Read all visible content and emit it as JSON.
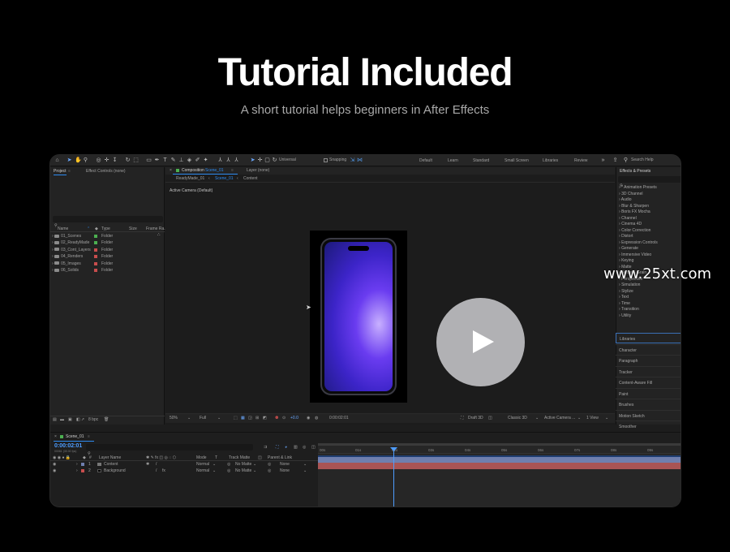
{
  "hero": {
    "title": "Tutorial Included",
    "subtitle": "A short tutorial helps beginners in After Effects"
  },
  "watermark": "www.25xt.com",
  "toolbar": {
    "universal_label": "Universal",
    "snapping_label": "Snapping",
    "workspaces": [
      "Default",
      "Learn",
      "Standard",
      "Small Screen",
      "Libraries",
      "Review"
    ],
    "search_placeholder": "Search Help"
  },
  "project_panel": {
    "tab_project": "Project",
    "tab_effect_controls": "Effect Controls (none)",
    "columns": [
      "Name",
      "Type",
      "Size",
      "Frame Ra..."
    ],
    "items": [
      {
        "name": "01_Scenes",
        "type": "Folder",
        "color": "#4caf50"
      },
      {
        "name": "02_ReadyMade",
        "type": "Folder",
        "color": "#4caf50"
      },
      {
        "name": "03_Cont_Layers",
        "type": "Folder",
        "color": "#c84d4d"
      },
      {
        "name": "04_Renders",
        "type": "Folder",
        "color": "#c84d4d"
      },
      {
        "name": "05_Images",
        "type": "Folder",
        "color": "#c84d4d"
      },
      {
        "name": "06_Solids",
        "type": "Folder",
        "color": "#c84d4d"
      }
    ],
    "bpc": "8 bpc"
  },
  "comp_panel": {
    "tab_composition": "Composition",
    "tab_comp_name": "Scene_01",
    "tab_layer": "Layer (none)",
    "breadcrumbs": [
      "ReadyMade_01",
      "Scene_01",
      "Content"
    ],
    "camera_label": "Active Camera (Default)",
    "zoom": "50%",
    "resolution": "Full",
    "exposure": "+0.0",
    "timecode": "0:00:02:01",
    "draft_label": "Draft 3D",
    "renderer": "Classic 3D",
    "camera_select": "Active Camera ...",
    "view_select": "1 View"
  },
  "effects_panel": {
    "title": "Effects & Presets",
    "items": [
      "* Animation Presets",
      "3D Channel",
      "Audio",
      "Blur & Sharpen",
      "Boris FX Mocha",
      "Channel",
      "Cinema 4D",
      "Color Correction",
      "Distort",
      "Expression Controls",
      "Generate",
      "Immersive Video",
      "Keying",
      "Matte",
      "Noise & Grain",
      "Perspective",
      "Simulation",
      "Stylize",
      "Text",
      "Time",
      "Transition",
      "Utility"
    ],
    "panels": [
      "Libraries",
      "Character",
      "Paragraph",
      "Tracker",
      "Content-Aware Fill",
      "Paint",
      "Brushes",
      "Motion Sketch",
      "Smoother"
    ]
  },
  "timeline": {
    "tab_name": "Scene_01",
    "timecode": "0:00:02:01",
    "frame_info": "00061 (30.00 fps)",
    "col_layer_name": "Layer Name",
    "col_mode": "Mode",
    "col_track_matte": "Track Matte",
    "col_parent": "Parent & Link",
    "ruler": [
      "00s",
      "01s",
      "02s",
      "03s",
      "04s",
      "05s",
      "06s",
      "07s",
      "08s",
      "09s"
    ],
    "layers": [
      {
        "num": "1",
        "name": "Content",
        "mode": "Normal",
        "matte": "No Matte",
        "parent": "None",
        "color": "#6f7fae"
      },
      {
        "num": "2",
        "name": "Background",
        "mode": "Normal",
        "matte": "No Matte",
        "parent": "None",
        "color": "#c84d4d"
      }
    ]
  },
  "colors": {
    "accent_blue": "#2e8bf0",
    "layer1_bar": "#6f7fae",
    "layer2_bar": "#a95454",
    "screen_purple": "#4b2ad8"
  }
}
